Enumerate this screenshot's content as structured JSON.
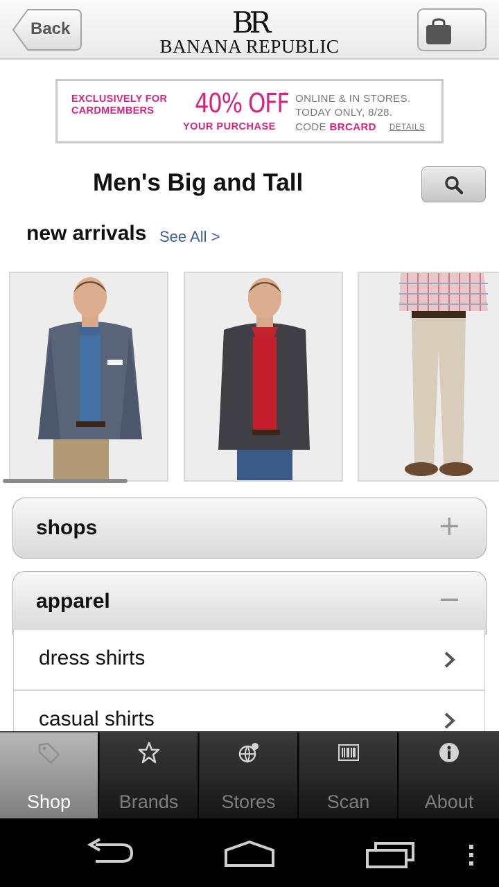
{
  "header": {
    "back_label": "Back",
    "logo_mark": "BR",
    "logo_text": "BANANA REPUBLIC"
  },
  "promo": {
    "exclusively": "EXCLUSIVELY FOR CARDMEMBERS",
    "headline": "40% OFF",
    "asterisk": "*",
    "your_purchase": "YOUR PURCHASE",
    "line1": "ONLINE & IN STORES.",
    "line2": "TODAY ONLY, 8/28.",
    "code_prefix": "CODE",
    "code": "BRCARD",
    "details": "DETAILS"
  },
  "page": {
    "title": "Men's Big and Tall",
    "new_arrivals": "new arrivals",
    "see_all": "See All >"
  },
  "accordion": {
    "shops": {
      "label": "shops",
      "sign": "+"
    },
    "apparel": {
      "label": "apparel",
      "sign": "−",
      "items": [
        {
          "label": "dress shirts"
        },
        {
          "label": "casual shirts"
        }
      ]
    }
  },
  "tabs": [
    {
      "label": "Shop",
      "icon": "tag-icon",
      "active": true
    },
    {
      "label": "Brands",
      "icon": "star-icon",
      "active": false
    },
    {
      "label": "Stores",
      "icon": "globe-icon",
      "active": false
    },
    {
      "label": "Scan",
      "icon": "barcode-icon",
      "active": false
    },
    {
      "label": "About",
      "icon": "info-icon",
      "active": false
    }
  ],
  "colors": {
    "promo_pink": "#d6237f",
    "link_blue": "#3d5f95",
    "tab_active": "#9c9c9c"
  }
}
